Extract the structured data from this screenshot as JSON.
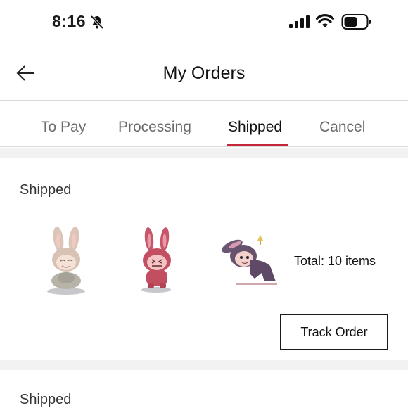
{
  "status_bar": {
    "time": "8:16",
    "icons": [
      "bell-slash-icon",
      "signal-icon",
      "wifi-icon",
      "battery-icon"
    ]
  },
  "header": {
    "title": "My Orders",
    "back_icon": "arrow-left-icon"
  },
  "tabs": [
    {
      "label": "To Pay",
      "active": false
    },
    {
      "label": "Processing",
      "active": false
    },
    {
      "label": "Shipped",
      "active": true
    },
    {
      "label": "Cancel",
      "active": false
    }
  ],
  "colors": {
    "accent": "#c4263b",
    "background_gap": "#f2f2f2",
    "text_primary": "#111111",
    "text_secondary": "#6b6b6b"
  },
  "orders": [
    {
      "status": "Shipped",
      "items": [
        {
          "name": "beige-labubu-figure"
        },
        {
          "name": "pink-labubu-figure"
        },
        {
          "name": "purple-labubu-figure"
        }
      ],
      "total_text": "Total: 10 items",
      "track_button": "Track Order"
    },
    {
      "status": "Shipped"
    }
  ]
}
